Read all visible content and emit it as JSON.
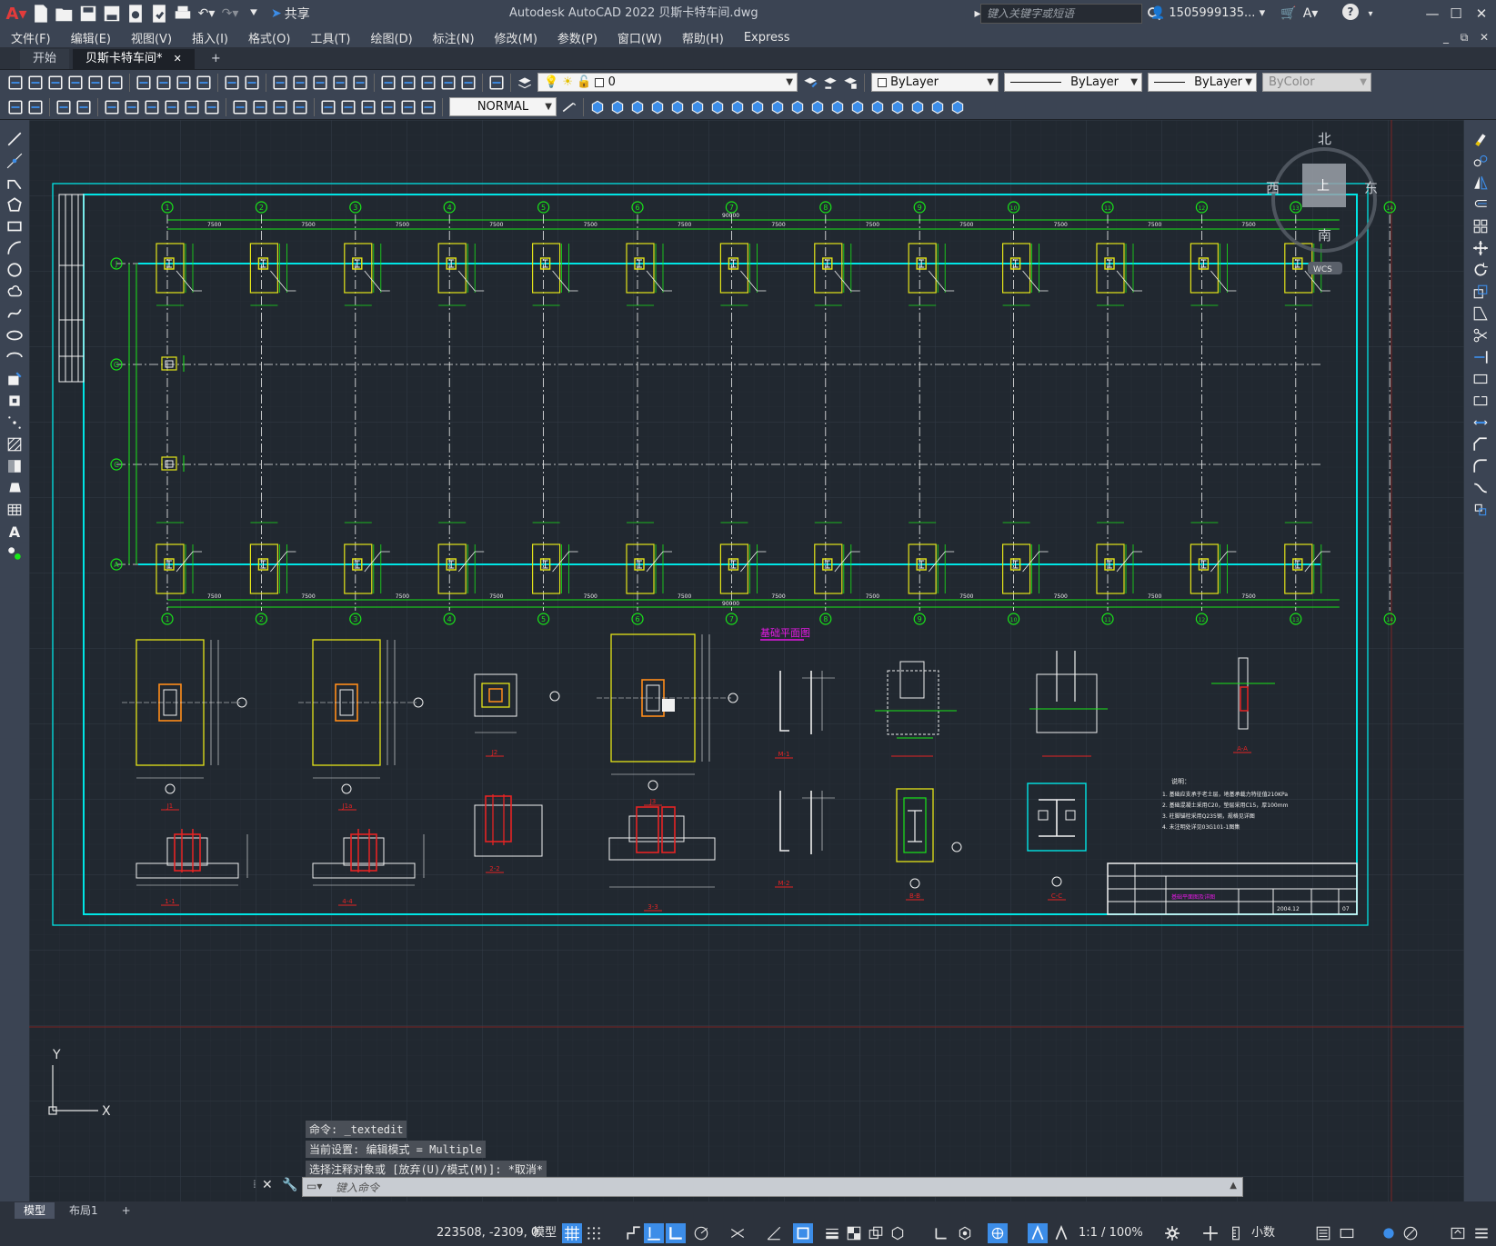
{
  "titlebar": {
    "app_title": "Autodesk AutoCAD 2022    贝斯卡特车间.dwg",
    "share_label": "共享",
    "search_placeholder": "键入关键字或短语",
    "user_name": "1505999135..."
  },
  "menubar": {
    "items": [
      "文件(F)",
      "编辑(E)",
      "视图(V)",
      "插入(I)",
      "格式(O)",
      "工具(T)",
      "绘图(D)",
      "标注(N)",
      "修改(M)",
      "参数(P)",
      "窗口(W)",
      "帮助(H)",
      "Express"
    ]
  },
  "filetabs": {
    "start": "开始",
    "active": "贝斯卡特车间*",
    "add": "+"
  },
  "properties": {
    "layer_value": "0",
    "color_value": "ByLayer",
    "linetype_value": "ByLayer",
    "lineweight_value": "ByLayer",
    "plotstyle_value": "ByColor",
    "dimstyle_value": "NORMAL"
  },
  "viewcube": {
    "north": "北",
    "south": "南",
    "east": "东",
    "west": "西",
    "top": "上",
    "wcs": "WCS"
  },
  "drawing": {
    "grid_cols": [
      "1",
      "2",
      "3",
      "4",
      "5",
      "6",
      "7",
      "8",
      "9",
      "10",
      "11",
      "12",
      "13",
      "14"
    ],
    "grid_rows": [
      "J",
      "G",
      "C",
      "A"
    ],
    "bay_dim": "7500",
    "total_dim": "90000",
    "plan_title": "基础平面图",
    "section_labels": [
      "J1",
      "J1a",
      "J2",
      "J3",
      "M-1",
      "M-2",
      "B-B",
      "C-C",
      "A-A",
      "1-1",
      "4-4",
      "2-2",
      "3-3"
    ],
    "notes_title": "说明：",
    "notes": [
      "1. 基础应支承于老土层，地基承载力特征值210KPa",
      "2. 基础混凝土采用C20，垫层采用C15，厚100mm",
      "3. 柱脚锚栓采用Q235钢，规格见详图",
      "4. 未注明处详见03G101-1图集"
    ],
    "title_block": {
      "drawing_name": "基础平面图及详图",
      "date": "2004.12",
      "sheet": "07"
    }
  },
  "ucs": {
    "x": "X",
    "y": "Y"
  },
  "command": {
    "history": [
      "命令: _textedit",
      "当前设置: 编辑模式 = Multiple",
      "选择注释对象或 [放弃(U)/模式(M)]: *取消*"
    ],
    "prompt": "键入命令"
  },
  "layouttabs": {
    "model": "模型",
    "layout1": "布局1",
    "add": "+"
  },
  "statusbar": {
    "coordinates": "223508, -2309, 0",
    "model_label": "模型",
    "scale": "1:1 / 100%",
    "units": "小数"
  },
  "colors": {
    "accent": "#3c8de8",
    "canvas": "#212830",
    "cyan": "#00e5e5",
    "green": "#19e619",
    "yellow": "#e5e519",
    "magenta": "#e519e5",
    "red": "#e52424",
    "white": "#f0f0f0"
  },
  "icons": {
    "toolbar1": [
      "new-icon",
      "open-icon",
      "save-icon",
      "print-icon",
      "print-preview-icon",
      "publish-icon",
      "cut-icon",
      "copy-icon",
      "paste-icon",
      "match-prop-icon",
      "undo-icon",
      "redo-icon",
      "pan-icon",
      "zoom-realtime-icon",
      "zoom-window-icon",
      "zoom-previous-icon",
      "properties-icon",
      "design-center-icon",
      "tool-palette-icon",
      "sheet-set-icon",
      "markup-icon",
      "calculator-icon",
      "help-icon"
    ],
    "toolbar2": [
      "line-icon",
      "polyline-icon",
      "dim-linear-icon",
      "dim-aligned-icon",
      "dim-arc-icon",
      "dim-ordinate-icon",
      "dim-radius-icon",
      "dim-jog-icon",
      "dim-diameter-icon",
      "dim-angular-icon",
      "quick-dim-icon",
      "dim-baseline-icon",
      "dim-continue-icon",
      "tolerance-icon",
      "center-mark-icon",
      "inspect-icon",
      "jog-linear-icon",
      "dim-edit-icon",
      "dim-text-edit-icon",
      "dim-update-icon"
    ]
  }
}
